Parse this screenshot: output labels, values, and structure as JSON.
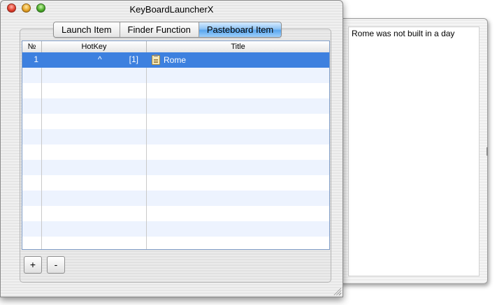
{
  "window": {
    "title": "KeyBoardLauncherX"
  },
  "tabs": [
    {
      "label": "Launch Item",
      "active": false
    },
    {
      "label": "Finder Function",
      "active": false
    },
    {
      "label": "Pasteboard Item",
      "active": true
    }
  ],
  "table": {
    "columns": [
      "№",
      "HotKey",
      "Title"
    ],
    "rows": [
      {
        "number": "1",
        "modifier": "^",
        "key": "[1]",
        "title": "Rome",
        "icon": "clipboard-icon",
        "selected": true
      }
    ]
  },
  "buttons": {
    "add_label": "+",
    "remove_label": "-"
  },
  "drawer": {
    "text": "Rome was not built in a day"
  },
  "colors": {
    "selection": "#3d80df",
    "active_tab": "#5aa6ee"
  }
}
